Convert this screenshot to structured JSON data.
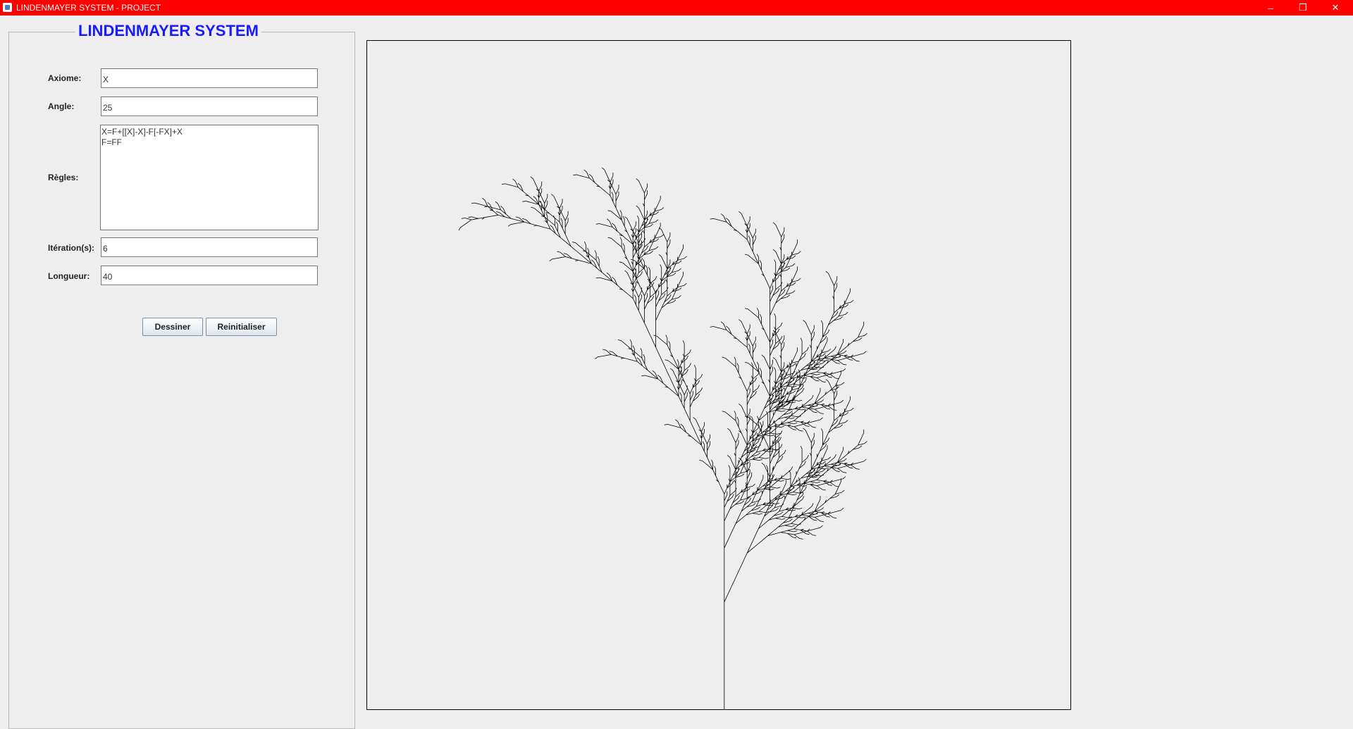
{
  "window": {
    "title": "LINDENMAYER SYSTEM - PROJECT",
    "controls": {
      "minimize": "–",
      "restore": "❐",
      "close": "✕"
    },
    "title_bar_color": "#ff0000"
  },
  "panel": {
    "title": "LINDENMAYER SYSTEM",
    "title_color": "#1a1aff",
    "fields": {
      "axiom": {
        "label": "Axiome:",
        "value": "X"
      },
      "angle": {
        "label": "Angle:",
        "value": "25"
      },
      "rules": {
        "label": "Règles:",
        "lines": [
          "X=F+[[X]-X]-F[-FX]+X",
          "F=FF"
        ]
      },
      "iterations": {
        "label": "Itération(s):",
        "value": "6"
      },
      "length": {
        "label": "Longueur:",
        "value": "40"
      }
    },
    "buttons": {
      "draw": "Dessiner",
      "reset": "Reinitialiser"
    }
  },
  "canvas": {
    "stroke_color": "#000000",
    "drawing": "fractal-plant"
  }
}
